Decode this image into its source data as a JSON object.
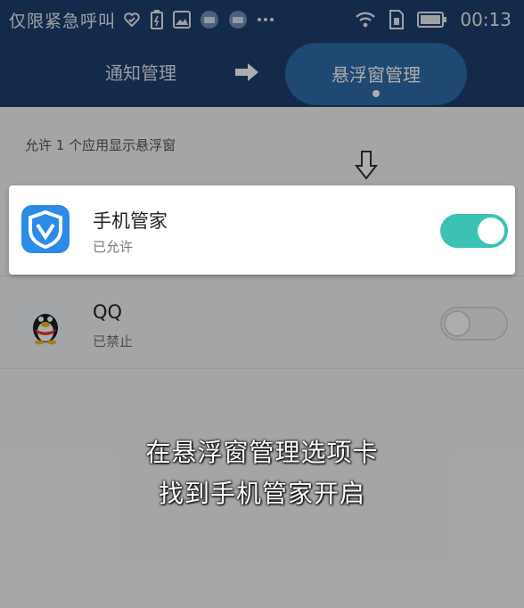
{
  "status_bar": {
    "carrier": "仅限紧急呼叫",
    "time": "00:13",
    "icons": [
      "heart-shield-icon",
      "battery-alert-icon",
      "image-icon",
      "app-badge-icon",
      "app-badge-icon",
      "more-dots-icon",
      "wifi-icon",
      "sim-icon",
      "battery-icon"
    ]
  },
  "tabs": {
    "notify_label": "通知管理",
    "float_label": "悬浮窗管理",
    "active": "float"
  },
  "section": {
    "label": "允许 1 个应用显示悬浮窗"
  },
  "apps": [
    {
      "name": "手机管家",
      "status": "已允许",
      "icon": "shield-v-icon",
      "enabled": true,
      "accent": "#2b8be6"
    },
    {
      "name": "QQ",
      "status": "已禁止",
      "icon": "penguin-icon",
      "enabled": false,
      "accent": "#1d1d1d"
    }
  ],
  "caption": {
    "line1": "在悬浮窗管理选项卡",
    "line2": "找到手机管家开启"
  },
  "colors": {
    "header": "#1c3f6e",
    "active_tab": "#2f6ba8",
    "toggle_on": "#3cc2b4"
  }
}
